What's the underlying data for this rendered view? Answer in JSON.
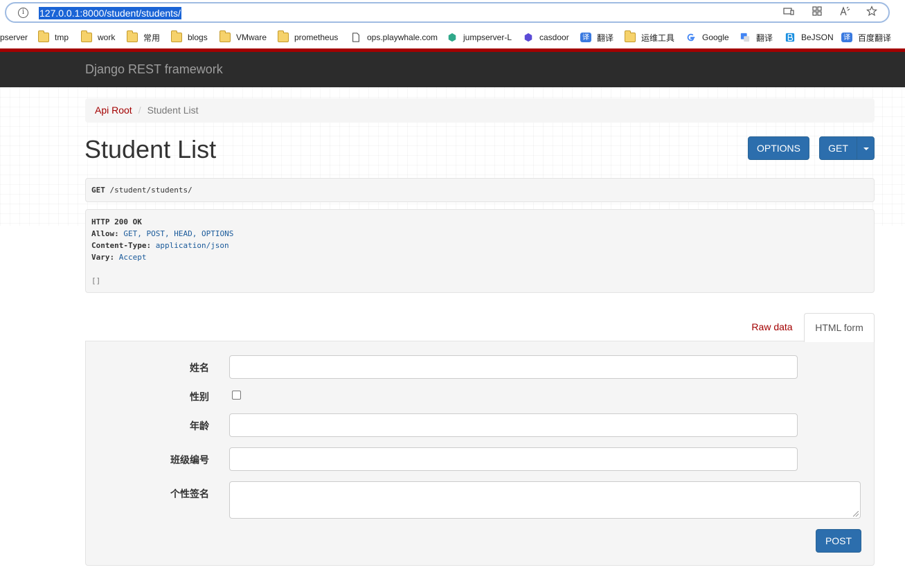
{
  "browser": {
    "url": "127.0.0.1:8000/student/students/",
    "bookmarks": [
      {
        "label": "pserver",
        "icon": "none"
      },
      {
        "label": "tmp",
        "icon": "folder-icon"
      },
      {
        "label": "work",
        "icon": "folder-icon"
      },
      {
        "label": "常用",
        "icon": "folder-icon"
      },
      {
        "label": "blogs",
        "icon": "folder-icon"
      },
      {
        "label": "VMware",
        "icon": "folder-icon"
      },
      {
        "label": "prometheus",
        "icon": "folder-icon"
      },
      {
        "label": "ops.playwhale.com",
        "icon": "page-icon"
      },
      {
        "label": "jumpserver-L",
        "icon": "jumpserver-icon"
      },
      {
        "label": "casdoor",
        "icon": "casdoor-icon"
      },
      {
        "label": "翻译",
        "icon": "translate-icon"
      },
      {
        "label": "运维工具",
        "icon": "folder-icon"
      },
      {
        "label": "Google",
        "icon": "google-icon"
      },
      {
        "label": "翻译",
        "icon": "google-translate-icon"
      },
      {
        "label": "BeJSON",
        "icon": "bejson-icon"
      },
      {
        "label": "百度翻译",
        "icon": "translate-icon"
      }
    ]
  },
  "navbar": {
    "brand": "Django REST framework"
  },
  "breadcrumb": {
    "root": "Api Root",
    "sep": "/",
    "current": "Student List"
  },
  "page": {
    "title": "Student List"
  },
  "actions": {
    "options_label": "OPTIONS",
    "get_label": "GET"
  },
  "request": {
    "method": "GET",
    "path": "/student/students/"
  },
  "response": {
    "status": "HTTP 200 OK",
    "headers": [
      {
        "name": "Allow:",
        "value": "GET, POST, HEAD, OPTIONS"
      },
      {
        "name": "Content-Type:",
        "value": "application/json"
      },
      {
        "name": "Vary:",
        "value": "Accept"
      }
    ],
    "body": "[]"
  },
  "tabs": {
    "raw": "Raw data",
    "html": "HTML form"
  },
  "form": {
    "fields": [
      {
        "label": "姓名",
        "type": "text",
        "value": ""
      },
      {
        "label": "性别",
        "type": "checkbox",
        "checked": false
      },
      {
        "label": "年龄",
        "type": "text",
        "value": ""
      },
      {
        "label": "班级编号",
        "type": "text",
        "value": ""
      },
      {
        "label": "个性签名",
        "type": "textarea",
        "value": ""
      }
    ],
    "submit_label": "POST"
  },
  "colors": {
    "accent": "#a30000",
    "button": "#2c6ead",
    "navbar": "#2c2c2c"
  }
}
